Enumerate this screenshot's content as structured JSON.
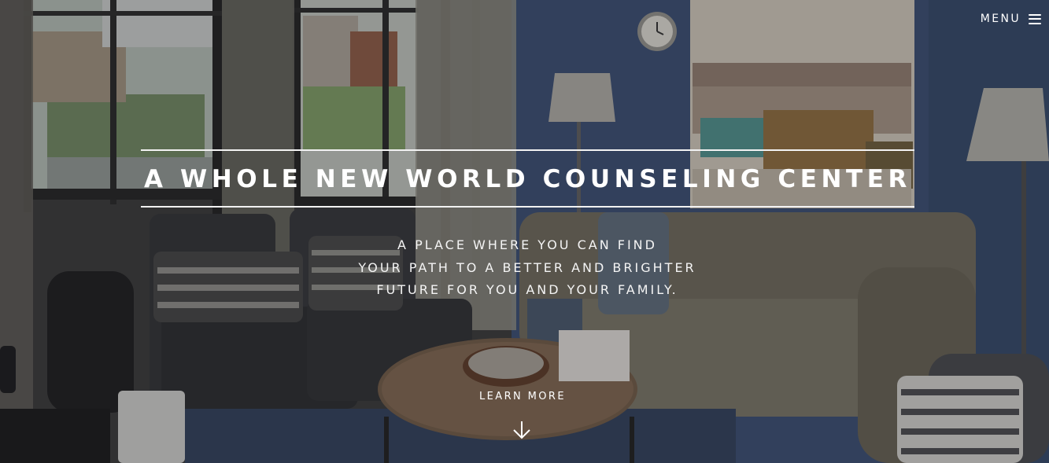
{
  "nav": {
    "menu_label": "MENU",
    "menu_icon": "hamburger-icon"
  },
  "hero": {
    "title": "A WHOLE NEW WORLD COUNSELING CENTER",
    "subtitle_lines": [
      "A PLACE WHERE YOU CAN FIND",
      "YOUR PATH TO A BETTER AND BRIGHTER",
      "FUTURE FOR YOU AND YOUR FAMILY."
    ],
    "cta_label": "LEARN MORE",
    "cta_icon": "arrow-down-icon"
  },
  "colors": {
    "text": "#ffffff",
    "wall": "#3c4f72",
    "sofa": "#6b6659",
    "chairs": "#34353a",
    "window_light": "#c9cec9"
  }
}
